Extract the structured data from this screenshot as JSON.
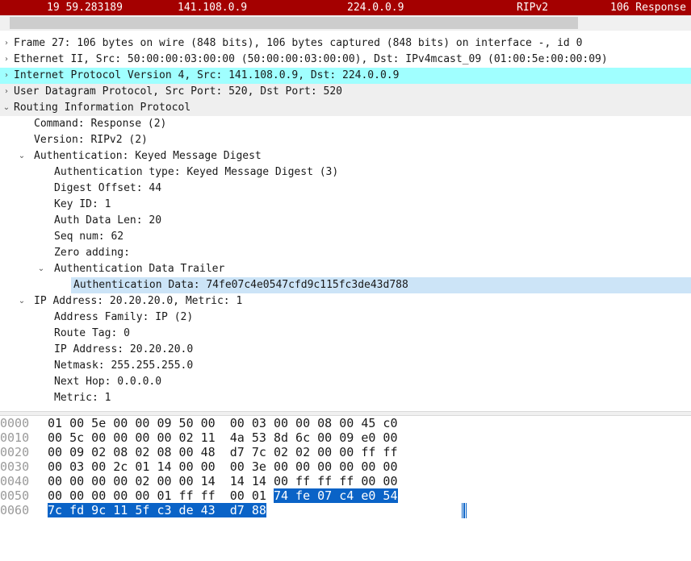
{
  "packet_list": {
    "selected_row": {
      "no_time": "19 59.283189",
      "source": "141.108.0.9",
      "destination": "224.0.0.9",
      "protocol": "RIPv2",
      "length_info": "106 Response"
    }
  },
  "details": {
    "frame": "Frame 27: 106 bytes on wire (848 bits), 106 bytes captured (848 bits) on interface -, id 0",
    "ethernet": "Ethernet II, Src: 50:00:00:03:00:00 (50:00:00:03:00:00), Dst: IPv4mcast_09 (01:00:5e:00:00:09)",
    "ip": "Internet Protocol Version 4, Src: 141.108.0.9, Dst: 224.0.0.9",
    "udp": "User Datagram Protocol, Src Port: 520, Dst Port: 520",
    "rip": "Routing Information Protocol",
    "command": "Command: Response (2)",
    "version": "Version: RIPv2 (2)",
    "auth": "Authentication: Keyed Message Digest",
    "auth_type": "Authentication type: Keyed Message Digest (3)",
    "digest_offset": "Digest Offset: 44",
    "key_id": "Key ID: 1",
    "auth_data_len": "Auth Data Len: 20",
    "seq_num": "Seq num: 62",
    "zero_adding": "Zero adding:",
    "auth_trailer": "Authentication Data Trailer",
    "auth_data": "Authentication Data: 74fe07c4e0547cfd9c115fc3de43d788",
    "ip_address_entry": "IP Address: 20.20.20.0, Metric: 1",
    "address_family": "Address Family: IP (2)",
    "route_tag": "Route Tag: 0",
    "ip_address": "IP Address: 20.20.20.0",
    "netmask": "Netmask: 255.255.255.0",
    "next_hop": "Next Hop: 0.0.0.0",
    "metric": "Metric: 1"
  },
  "hex": {
    "rows": [
      {
        "offset": "0000",
        "bytes": "01 00 5e 00 00 09 50 00  00 03 00 00 08 00 45 c0"
      },
      {
        "offset": "0010",
        "bytes": "00 5c 00 00 00 00 02 11  4a 53 8d 6c 00 09 e0 00"
      },
      {
        "offset": "0020",
        "bytes": "00 09 02 08 02 08 00 48  d7 7c 02 02 00 00 ff ff"
      },
      {
        "offset": "0030",
        "bytes": "00 03 00 2c 01 14 00 00  00 3e 00 00 00 00 00 00"
      },
      {
        "offset": "0040",
        "bytes": "00 00 00 00 02 00 00 14  14 14 00 ff ff ff 00 00"
      },
      {
        "offset": "0050",
        "bytes_plain": "00 00 00 00 00 01 ff ff  00 01 ",
        "bytes_sel": "74 fe 07 c4 e0 54"
      },
      {
        "offset": "0060",
        "bytes_sel": "7c fd 9c 11 5f c3 de 43  d7 88"
      }
    ]
  }
}
